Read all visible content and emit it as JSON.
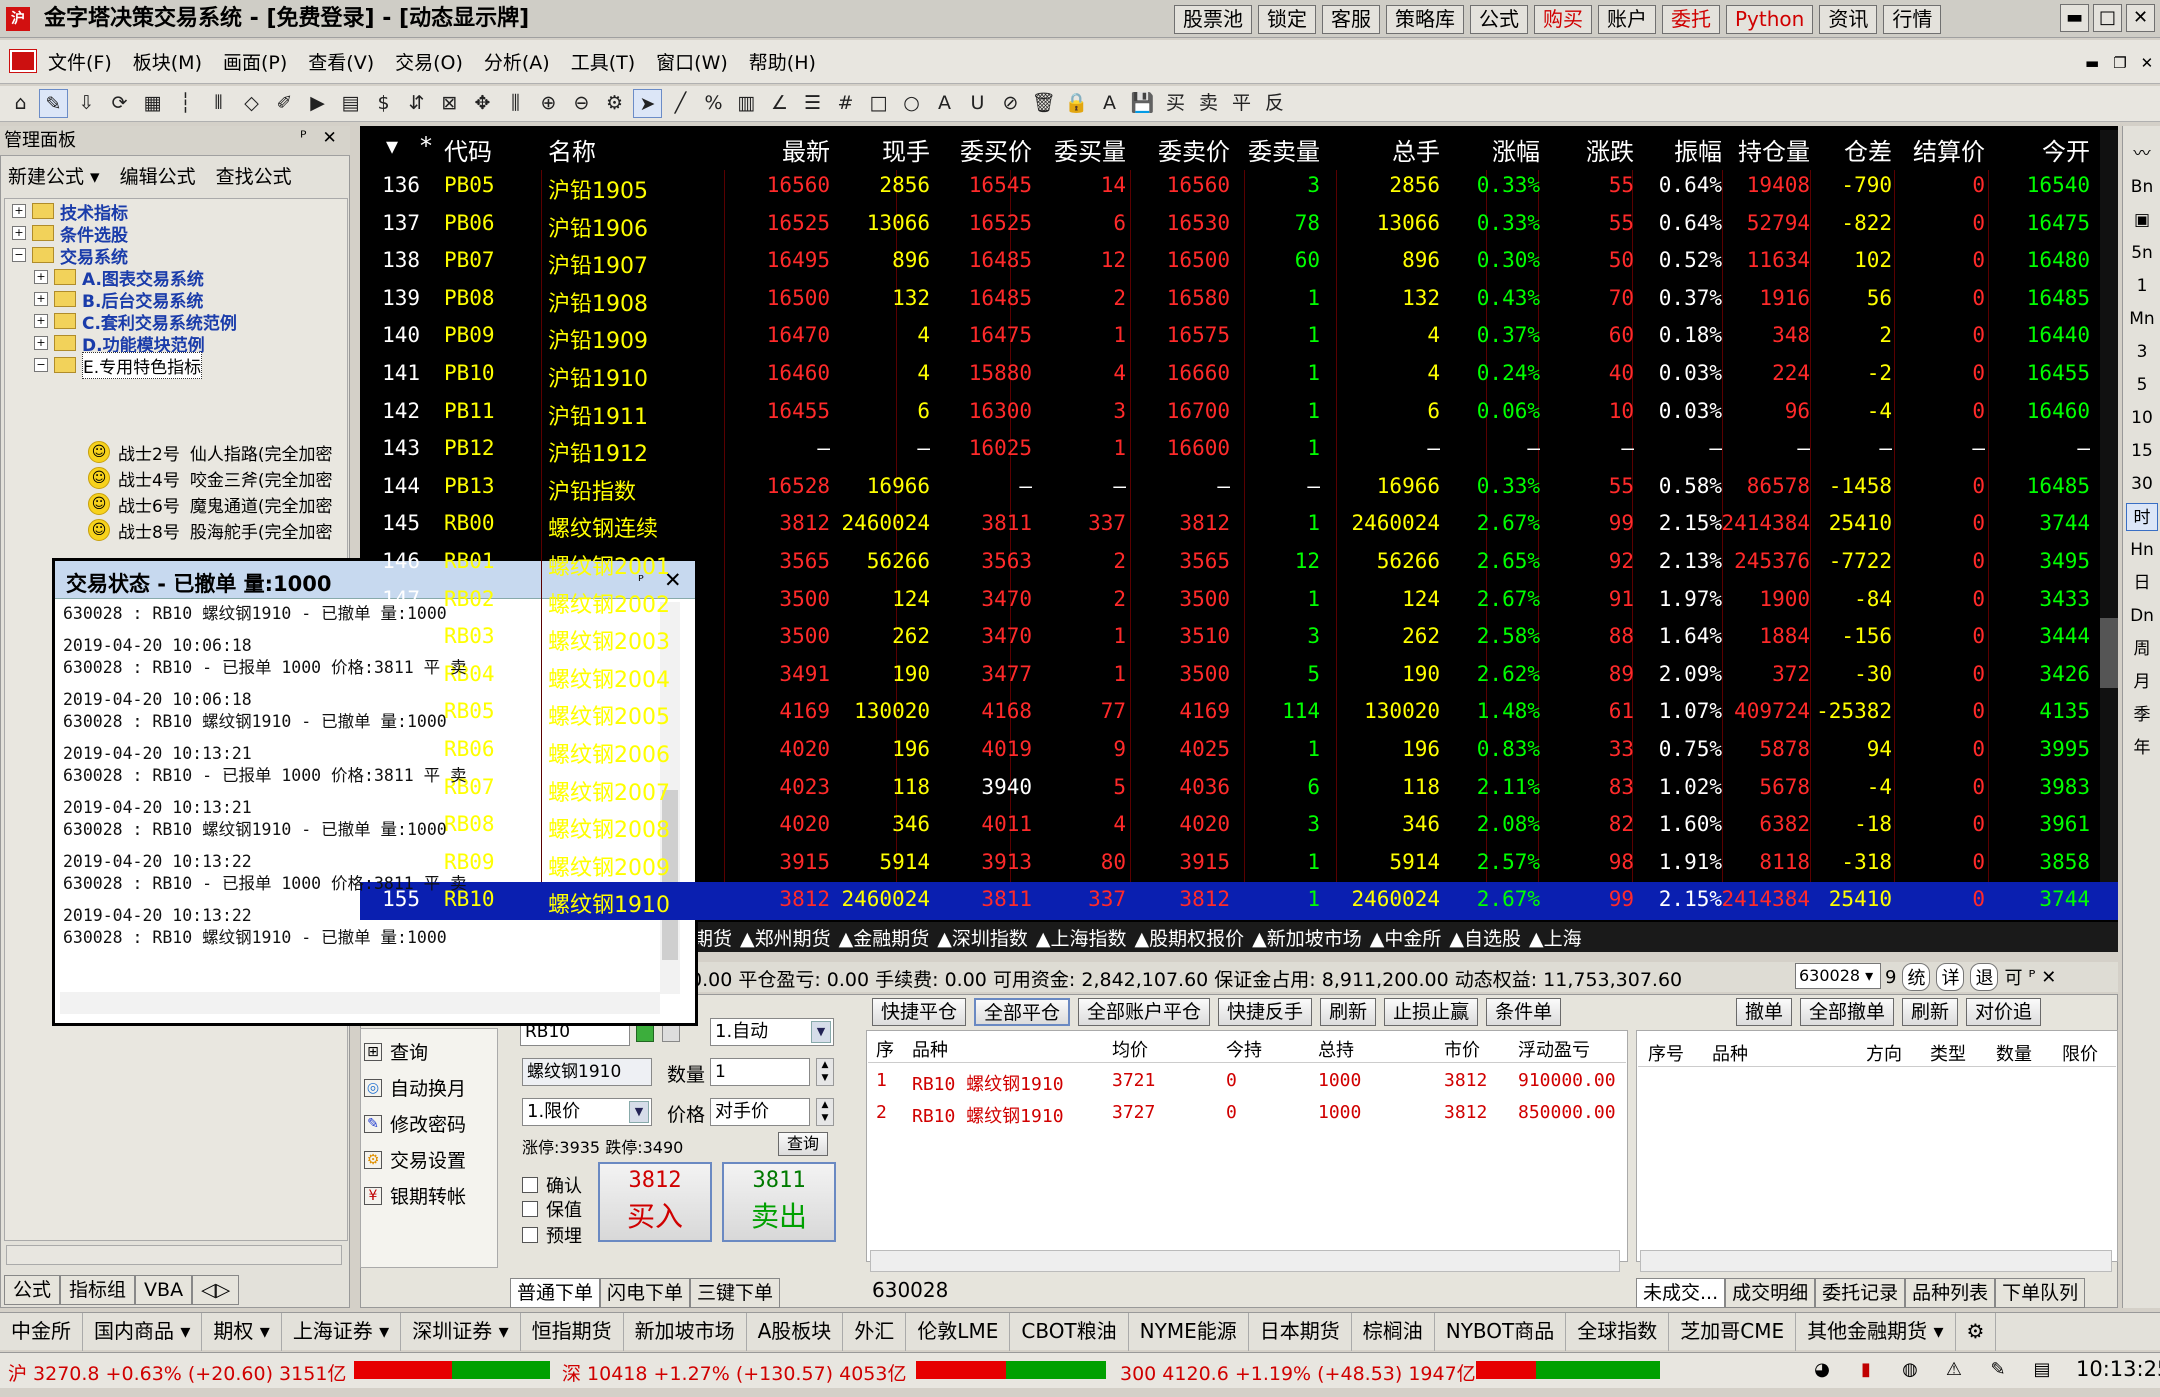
{
  "titlebar": {
    "title": "金字塔决策交易系统 - [免费登录] - [动态显示牌]",
    "buttons": [
      "股票池",
      "锁定",
      "客服",
      "策略库",
      "公式",
      "购买",
      "账户",
      "委托",
      "Python",
      "资讯",
      "行情"
    ],
    "red_buttons": [
      "购买",
      "委托",
      "Python"
    ],
    "window_controls": [
      "▬",
      "□",
      "✕"
    ]
  },
  "menu": {
    "items": [
      "文件(F)",
      "板块(M)",
      "画面(P)",
      "查看(V)",
      "交易(O)",
      "分析(A)",
      "工具(T)",
      "窗口(W)",
      "帮助(H)"
    ],
    "right": [
      "▬",
      "❐",
      "✕"
    ]
  },
  "toolbar": {
    "icons": [
      "⌂",
      "✎",
      "⇩",
      "⟳",
      "▦",
      "┆",
      "⫴",
      "◇",
      "✐",
      "▶",
      "▤",
      "$",
      "⇵",
      "⊠",
      "✥",
      "⫼",
      "⊕",
      "⊖",
      "⚙",
      "➤",
      "╱",
      "%",
      "▥",
      "∠",
      "☰",
      "#",
      "□",
      "○",
      "A",
      "U",
      "⊘",
      "🗑",
      "🔒",
      "A",
      "💾",
      "买",
      "卖",
      "平",
      "反"
    ]
  },
  "mgmt": {
    "title": "管理面板",
    "controls": [
      "ᴾ",
      "✕"
    ],
    "tools": [
      "新建公式 ▾",
      "编辑公式",
      "查找公式"
    ],
    "tree": [
      {
        "label": "技术指标",
        "level": 0,
        "exp": "+"
      },
      {
        "label": "条件选股",
        "level": 0,
        "exp": "+"
      },
      {
        "label": "交易系统",
        "level": 0,
        "exp": "−"
      },
      {
        "label": "A.图表交易系统",
        "level": 1,
        "exp": "+"
      },
      {
        "label": "B.后台交易系统",
        "level": 1,
        "exp": "+"
      },
      {
        "label": "C.套利交易系统范例",
        "level": 1,
        "exp": "+"
      },
      {
        "label": "D.功能模块范例",
        "level": 1,
        "exp": "+"
      },
      {
        "label": "E.专用特色指标",
        "level": 1,
        "exp": "−"
      }
    ],
    "leaves": [
      {
        "name": "战士2号",
        "desc": "仙人指路(完全加密"
      },
      {
        "name": "战士4号",
        "desc": "咬金三斧(完全加密"
      },
      {
        "name": "战士6号",
        "desc": "魔鬼通道(完全加密"
      },
      {
        "name": "战士8号",
        "desc": "股海舵手(完全加密"
      }
    ],
    "tabs": [
      "公式",
      "指标组",
      "VBA",
      "◁▷"
    ]
  },
  "quote": {
    "headers": [
      "▾",
      "*",
      "代码",
      "名称",
      "最新",
      "现手",
      "委买价",
      "委买量",
      "委卖价",
      "委卖量",
      "总手",
      "涨幅",
      "涨跌",
      "振幅",
      "持仓量",
      "仓差",
      "结算价",
      "今开"
    ],
    "rows": [
      [
        "136",
        "PB05",
        "沪铅1905",
        "16560",
        "2856",
        "16545",
        "14",
        "16560",
        "3",
        "2856",
        "0.33%",
        "55",
        "0.64%",
        "19408",
        "-790",
        "0",
        "16540"
      ],
      [
        "137",
        "PB06",
        "沪铅1906",
        "16525",
        "13066",
        "16525",
        "6",
        "16530",
        "78",
        "13066",
        "0.33%",
        "55",
        "0.64%",
        "52794",
        "-822",
        "0",
        "16475"
      ],
      [
        "138",
        "PB07",
        "沪铅1907",
        "16495",
        "896",
        "16485",
        "12",
        "16500",
        "60",
        "896",
        "0.30%",
        "50",
        "0.52%",
        "11634",
        "102",
        "0",
        "16480"
      ],
      [
        "139",
        "PB08",
        "沪铅1908",
        "16500",
        "132",
        "16485",
        "2",
        "16580",
        "1",
        "132",
        "0.43%",
        "70",
        "0.37%",
        "1916",
        "56",
        "0",
        "16485"
      ],
      [
        "140",
        "PB09",
        "沪铅1909",
        "16470",
        "4",
        "16475",
        "1",
        "16575",
        "1",
        "4",
        "0.37%",
        "60",
        "0.18%",
        "348",
        "2",
        "0",
        "16440"
      ],
      [
        "141",
        "PB10",
        "沪铅1910",
        "16460",
        "4",
        "15880",
        "4",
        "16660",
        "1",
        "4",
        "0.24%",
        "40",
        "0.03%",
        "224",
        "-2",
        "0",
        "16455"
      ],
      [
        "142",
        "PB11",
        "沪铅1911",
        "16455",
        "6",
        "16300",
        "3",
        "16700",
        "1",
        "6",
        "0.06%",
        "10",
        "0.03%",
        "96",
        "-4",
        "0",
        "16460"
      ],
      [
        "143",
        "PB12",
        "沪铅1912",
        "—",
        "—",
        "16025",
        "1",
        "16600",
        "1",
        "—",
        "—",
        "—",
        "—",
        "—",
        "—",
        "—",
        "—"
      ],
      [
        "144",
        "PB13",
        "沪铅指数",
        "16528",
        "16966",
        "—",
        "—",
        "—",
        "—",
        "16966",
        "0.33%",
        "55",
        "0.58%",
        "86578",
        "-1458",
        "0",
        "16485"
      ],
      [
        "145",
        "RB00",
        "螺纹钢连续",
        "3812",
        "2460024",
        "3811",
        "337",
        "3812",
        "1",
        "2460024",
        "2.67%",
        "99",
        "2.15%",
        "2414384",
        "25410",
        "0",
        "3744"
      ],
      [
        "146",
        "RB01",
        "螺纹钢2001",
        "3565",
        "56266",
        "3563",
        "2",
        "3565",
        "12",
        "56266",
        "2.65%",
        "92",
        "2.13%",
        "245376",
        "-7722",
        "0",
        "3495"
      ],
      [
        "147",
        "RB02",
        "螺纹钢2002",
        "3500",
        "124",
        "3470",
        "2",
        "3500",
        "1",
        "124",
        "2.67%",
        "91",
        "1.97%",
        "1900",
        "-84",
        "0",
        "3433"
      ],
      [
        "148",
        "RB03",
        "螺纹钢2003",
        "3500",
        "262",
        "3470",
        "1",
        "3510",
        "3",
        "262",
        "2.58%",
        "88",
        "1.64%",
        "1884",
        "-156",
        "0",
        "3444"
      ],
      [
        "149",
        "RB04",
        "螺纹钢2004",
        "3491",
        "190",
        "3477",
        "1",
        "3500",
        "5",
        "190",
        "2.62%",
        "89",
        "2.09%",
        "372",
        "-30",
        "0",
        "3426"
      ],
      [
        "150",
        "RB05",
        "螺纹钢2005",
        "4169",
        "130020",
        "4168",
        "77",
        "4169",
        "114",
        "130020",
        "1.48%",
        "61",
        "1.07%",
        "409724",
        "-25382",
        "0",
        "4135"
      ],
      [
        "151",
        "RB06",
        "螺纹钢2006",
        "4020",
        "196",
        "4019",
        "9",
        "4025",
        "1",
        "196",
        "0.83%",
        "33",
        "0.75%",
        "5878",
        "94",
        "0",
        "3995"
      ],
      [
        "152",
        "RB07",
        "螺纹钢2007",
        "4023",
        "118",
        "3940",
        "5",
        "4036",
        "6",
        "118",
        "2.11%",
        "83",
        "1.02%",
        "5678",
        "-4",
        "0",
        "3983"
      ],
      [
        "153",
        "RB08",
        "螺纹钢2008",
        "4020",
        "346",
        "4011",
        "4",
        "4020",
        "3",
        "346",
        "2.08%",
        "82",
        "1.60%",
        "6382",
        "-18",
        "0",
        "3961"
      ],
      [
        "154",
        "RB09",
        "螺纹钢2009",
        "3915",
        "5914",
        "3913",
        "80",
        "3915",
        "1",
        "5914",
        "2.57%",
        "98",
        "1.91%",
        "8118",
        "-318",
        "0",
        "3858"
      ],
      [
        "155",
        "RB10",
        "螺纹钢1910",
        "3812",
        "2460024",
        "3811",
        "337",
        "3812",
        "1",
        "2460024",
        "2.67%",
        "99",
        "2.15%",
        "2414384",
        "25410",
        "0",
        "3744"
      ]
    ],
    "tabs": [
      "期货",
      "▲郑州期货",
      "▲金融期货",
      "▲深圳指数",
      "▲上海指数",
      "▲股期权报价",
      "▲新加坡市场",
      "▲中金所",
      "▲自选股",
      "▲上海"
    ],
    "colors": {
      "up": "#ff2a2a",
      "down": "#00ff00",
      "flat": "#ffffff",
      "code": "#ffff00",
      "name": "#ffff00"
    }
  },
  "right_strip": [
    "〰",
    "Bn",
    "▣",
    "5n",
    "1",
    "Mn",
    "3",
    "5",
    "10",
    "15",
    "30",
    "时",
    "Hn",
    "日",
    "Dn",
    "周",
    "月",
    "季",
    "年"
  ],
  "account": {
    "text": "0.00   平仓盈亏: 0.00   手续费: 0.00   可用资金: 2,842,107.60   保证金占用: 8,911,200.00   动态权益: 11,753,307.60",
    "account_id": "630028",
    "right_btns": [
      "9",
      "统",
      "详",
      "退",
      "可",
      "ᴾ",
      "✕"
    ]
  },
  "trade_menu": [
    {
      "icon": "⊞",
      "label": "查询"
    },
    {
      "icon": "◎",
      "label": "自动换月"
    },
    {
      "icon": "✎",
      "label": "修改密码"
    },
    {
      "icon": "⚙",
      "label": "交易设置"
    },
    {
      "icon": "¥",
      "label": "银期转帐"
    }
  ],
  "order": {
    "code": "RB10",
    "name": "螺纹钢1910",
    "mode": "1.自动",
    "qty_label": "数量",
    "qty": "1",
    "price_type": "1.限价",
    "price_label": "价格",
    "price": "对手价",
    "limits": "涨停:3935 跌停:3490",
    "query": "查询",
    "checks": [
      "确认",
      "保值",
      "预埋"
    ],
    "buy_price": "3812",
    "buy_label": "买入",
    "sell_price": "3811",
    "sell_label": "卖出",
    "tabs": [
      "普通下单",
      "闪电下单",
      "三键下单"
    ]
  },
  "positions": {
    "buttons": [
      "快捷平仓",
      "全部平仓",
      "全部账户平仓",
      "快捷反手",
      "刷新",
      "止损止赢",
      "条件单"
    ],
    "headers": [
      "序",
      "品种",
      "均价",
      "今持",
      "总持",
      "市价",
      "浮动盈亏"
    ],
    "rows": [
      [
        "1",
        "RB10 螺纹钢1910",
        "3721",
        "0",
        "1000",
        "3812",
        "910000.00"
      ],
      [
        "2",
        "RB10 螺纹钢1910",
        "3727",
        "0",
        "1000",
        "3812",
        "850000.00"
      ]
    ],
    "code": "630028"
  },
  "orders": {
    "buttons": [
      "撤单",
      "全部撤单",
      "刷新",
      "对价追"
    ],
    "headers": [
      "序号",
      "品种",
      "方向",
      "类型",
      "数量",
      "限价"
    ],
    "tabs": [
      "未成交...",
      "成交明细",
      "委托记录",
      "品种列表",
      "下单队列"
    ]
  },
  "market_tabs": [
    "中金所",
    "国内商品 ▾",
    "期权 ▾",
    "上海证券 ▾",
    "深圳证券 ▾",
    "恒指期货",
    "新加坡市场",
    "A股板块",
    "外汇",
    "伦敦LME",
    "CBOT粮油",
    "NYME能源",
    "日本期货",
    "棕榈油",
    "NYBOT商品",
    "全球指数",
    "芝加哥CME",
    "其他金融期货 ▾",
    "⚙"
  ],
  "status": {
    "sh": "沪 3270.8 +0.63% (+20.60) 3151亿",
    "sz": "深 10418 +1.27% (+130.57) 4053亿",
    "c300": "300 4120.6 +1.19% (+48.53) 1947亿",
    "tray": [
      "◕",
      "▮",
      "◍",
      "⚠",
      "✎",
      "▤"
    ],
    "time": "10:13:25"
  },
  "dialog": {
    "title": "交易状态 - 已撤单 量:1000",
    "controls": [
      "ᴾ",
      "✕"
    ],
    "lines": [
      "630028 : RB10 螺纹钢1910 - 已撤单 量:1000",
      "",
      "2019-04-20 10:06:18",
      "630028 : RB10 - 已报单 1000 价格:3811 平 卖",
      "",
      "2019-04-20 10:06:18",
      "630028 : RB10 螺纹钢1910 - 已撤单 量:1000",
      "",
      "2019-04-20 10:13:21",
      "630028 : RB10 - 已报单 1000 价格:3811 平 卖",
      "",
      "2019-04-20 10:13:21",
      "630028 : RB10 螺纹钢1910 - 已撤单 量:1000",
      "",
      "2019-04-20 10:13:22",
      "630028 : RB10 - 已报单 1000 价格:3811 平 卖",
      "",
      "2019-04-20 10:13:22",
      "630028 : RB10 螺纹钢1910 - 已撤单 量:1000"
    ]
  }
}
